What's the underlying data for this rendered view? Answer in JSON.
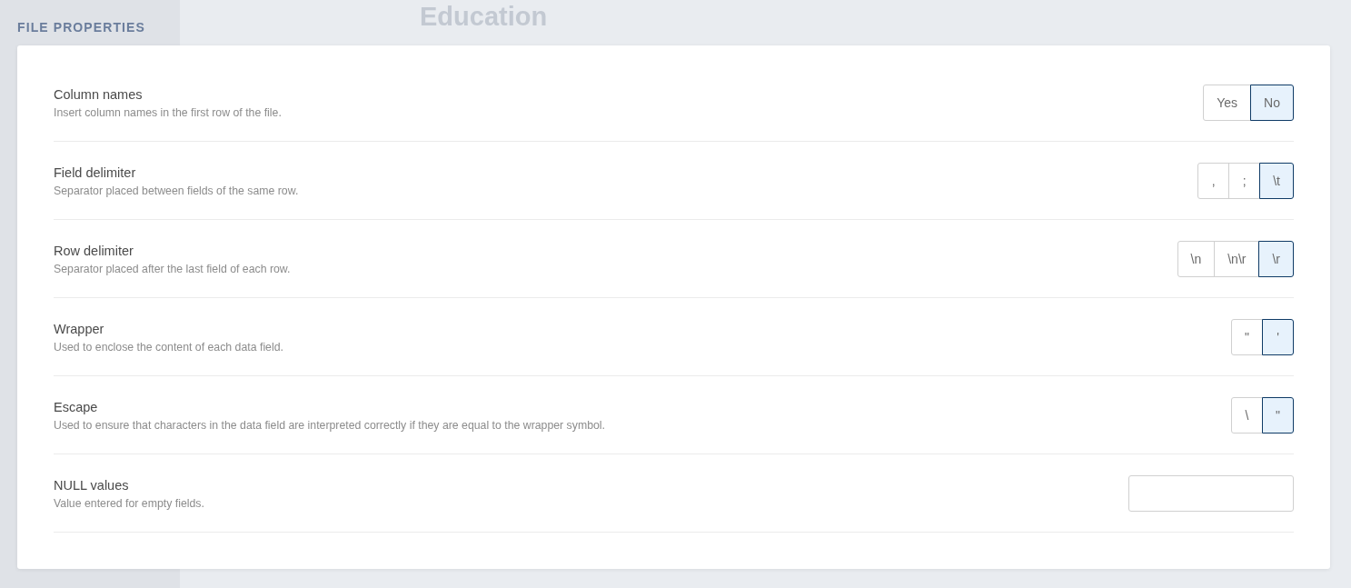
{
  "background": {
    "heading": "Education"
  },
  "panel": {
    "title": "FILE PROPERTIES",
    "settings": [
      {
        "kind": "choice",
        "label": "Column names",
        "description": "Insert column names in the first row of the file.",
        "options": [
          {
            "label": "Yes",
            "selected": false
          },
          {
            "label": "No",
            "selected": true
          }
        ]
      },
      {
        "kind": "choice",
        "label": "Field delimiter",
        "description": "Separator placed between fields of the same row.",
        "options": [
          {
            "label": ",",
            "selected": false
          },
          {
            "label": ";",
            "selected": false
          },
          {
            "label": "\\t",
            "selected": true
          }
        ]
      },
      {
        "kind": "choice",
        "label": "Row delimiter",
        "description": "Separator placed after the last field of each row.",
        "options": [
          {
            "label": "\\n",
            "selected": false
          },
          {
            "label": "\\n\\r",
            "selected": false
          },
          {
            "label": "\\r",
            "selected": true
          }
        ]
      },
      {
        "kind": "choice",
        "label": "Wrapper",
        "description": "Used to enclose the content of each data field.",
        "options": [
          {
            "label": "\"",
            "selected": false
          },
          {
            "label": "'",
            "selected": true
          }
        ]
      },
      {
        "kind": "choice",
        "label": "Escape",
        "description": "Used to ensure that characters in the data field are interpreted correctly if they are equal to the wrapper symbol.",
        "options": [
          {
            "label": "\\",
            "selected": false
          },
          {
            "label": "\"",
            "selected": true
          }
        ]
      },
      {
        "kind": "text",
        "label": "NULL values",
        "description": "Value entered for empty fields."
      }
    ]
  }
}
